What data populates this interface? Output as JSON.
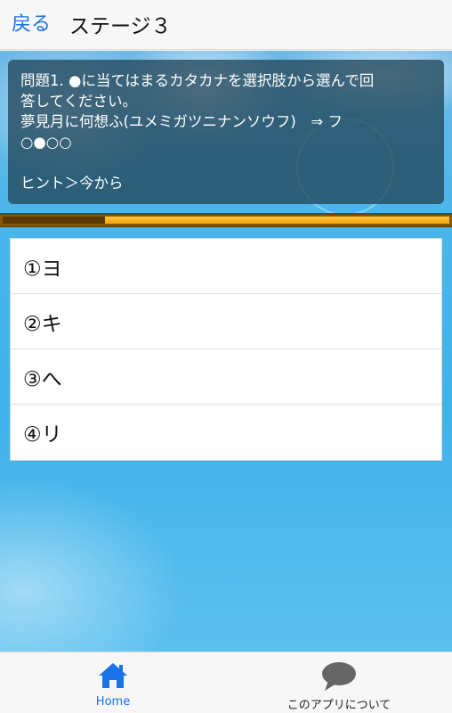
{
  "header": {
    "back_label": "戻る",
    "title": "ステージ３"
  },
  "question": {
    "line1": "問題1. ●に当てはまるカタカナを選択肢から選んで回",
    "line2": "答してください。",
    "line3": "夢見月に何想ふ(ユメミガツニナンソウフ)　⇒ フ",
    "line4": "○●○○",
    "hint": "ヒント＞今から"
  },
  "timer": {
    "remaining_fraction": 0.77
  },
  "choices": [
    {
      "label": "①ヨ"
    },
    {
      "label": "②キ"
    },
    {
      "label": "③へ"
    },
    {
      "label": "④リ"
    }
  ],
  "bottom_nav": {
    "home_label": "Home",
    "about_label": "このアプリについて",
    "home_icon": "house-icon",
    "about_icon": "speech-bubble-icon",
    "active_color": "#1a73e8"
  }
}
